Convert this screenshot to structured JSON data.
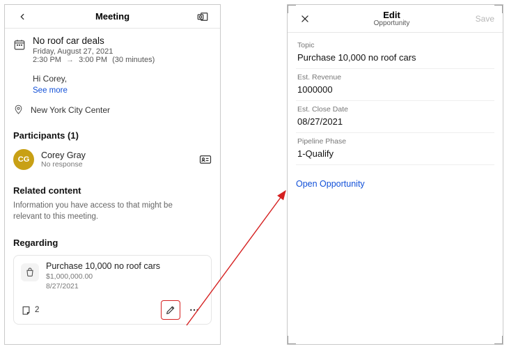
{
  "left": {
    "header_title": "Meeting",
    "event_title": "No roof car deals",
    "event_date": "Friday, August 27, 2021",
    "event_start": "2:30 PM",
    "event_end": "3:00 PM",
    "event_duration": "(30 minutes)",
    "greeting": "Hi Corey,",
    "see_more": "See more",
    "location": "New York City Center",
    "participants_heading": "Participants (1)",
    "participant_initials": "CG",
    "participant_name": "Corey Gray",
    "participant_status": "No response",
    "related_heading": "Related content",
    "related_sub": "Information you have access to that might be relevant to this meeting.",
    "regarding_heading": "Regarding",
    "card_title": "Purchase 10,000 no roof cars",
    "card_amount": "$1,000,000.00",
    "card_date": "8/27/2021",
    "note_count": "2"
  },
  "right": {
    "header_title": "Edit",
    "header_sub": "Opportunity",
    "save_label": "Save",
    "fields": {
      "topic_label": "Topic",
      "topic_value": "Purchase 10,000 no roof cars",
      "rev_label": "Est. Revenue",
      "rev_value": "1000000",
      "close_label": "Est. Close Date",
      "close_value": "08/27/2021",
      "phase_label": "Pipeline Phase",
      "phase_value": "1-Qualify"
    },
    "open_link": "Open Opportunity"
  }
}
